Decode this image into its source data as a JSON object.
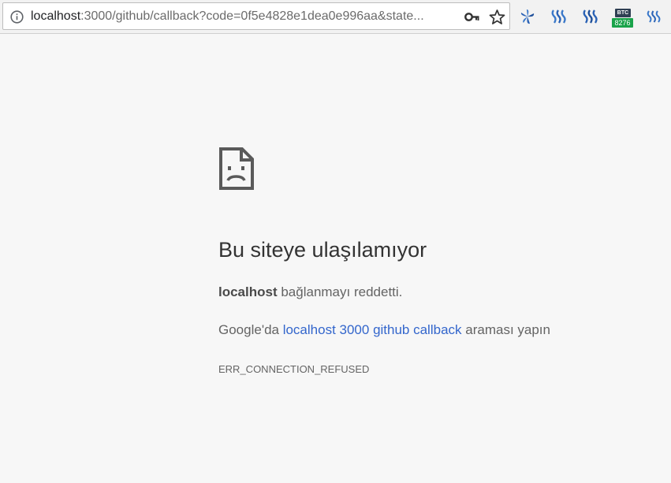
{
  "browser": {
    "url_host": "localhost",
    "url_rest": ":3000/github/callback?code=0f5e4828e1dea0e996aa&state...",
    "icons": {
      "info": "info-icon",
      "key": "key-icon",
      "star": "star-icon"
    },
    "extensions": [
      {
        "name": "pinwheel-extension-icon",
        "color": "#2a62b5"
      },
      {
        "name": "steem-extension-icon-1",
        "color": "#3a78c9"
      },
      {
        "name": "steem-extension-icon-2",
        "color": "#2a62b5"
      },
      {
        "name": "btc-ticker-extension",
        "label": "BTC",
        "badge": "8276",
        "badge_color": "#1aa34a"
      },
      {
        "name": "steem-extension-icon-3",
        "color": "#3a78c9"
      }
    ]
  },
  "error_page": {
    "icon": "sad-document-icon",
    "title": "Bu siteye ulaşılamıyor",
    "host_bold": "localhost",
    "host_message": " bağlanmayı reddetti.",
    "search_prefix": "Google'da ",
    "search_link": "localhost 3000 github callback",
    "search_suffix": " araması yapın",
    "error_code": "ERR_CONNECTION_REFUSED"
  },
  "colors": {
    "page_background": "#f7f7f7",
    "link": "#3366cc",
    "title_text": "#333333",
    "body_text": "#646464"
  }
}
